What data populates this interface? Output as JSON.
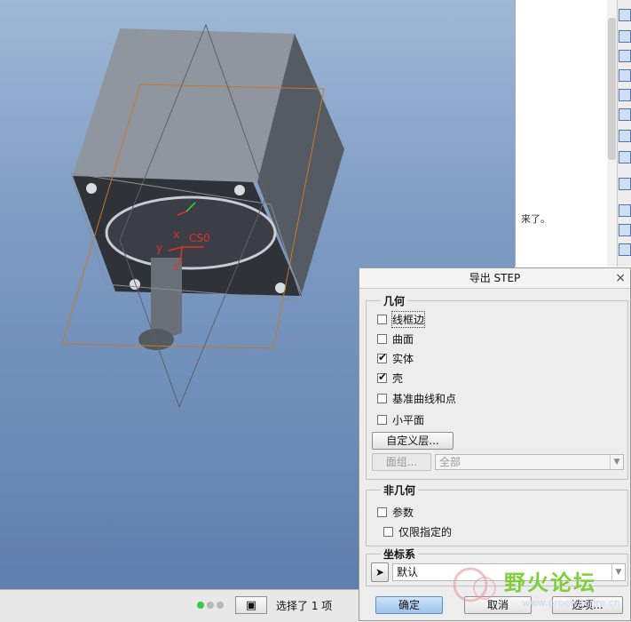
{
  "viewport": {
    "csys_label": "CS0",
    "axis_x": "x",
    "axis_y": "y",
    "axis_z": "z"
  },
  "side_panel": {
    "message": "来了。"
  },
  "dialog": {
    "title": "导出 STEP",
    "close": "×",
    "geometry_group": {
      "label": "几何",
      "items": [
        {
          "label": "线框边",
          "checked": false
        },
        {
          "label": "曲面",
          "checked": false
        },
        {
          "label": "实体",
          "checked": true
        },
        {
          "label": "壳",
          "checked": true
        },
        {
          "label": "基准曲线和点",
          "checked": false
        },
        {
          "label": "小平面",
          "checked": false
        }
      ],
      "custom_layers_button": "自定义层...",
      "quilts_button": "面组...",
      "quilts_select": "全部"
    },
    "nongeometry_group": {
      "label": "非几何",
      "params_label": "参数",
      "params_checked": false,
      "designated_only_label": "仅限指定的",
      "designated_only_checked": false
    },
    "csys_group": {
      "label": "坐标系",
      "select_value": "默认"
    },
    "ok_button": "确定",
    "cancel_button": "取消",
    "options_button": "选项..."
  },
  "status_bar": {
    "selection_text": "选择了 1 项"
  },
  "watermark": {
    "text": "野火论坛",
    "sub": "www.proewildfire.cn"
  },
  "colors": {
    "viewport_top": "#9fb8d6",
    "viewport_bottom": "#5f7fac",
    "motor_body": "#3a3d42",
    "datum_orange": "#c87a2a",
    "csys_red": "#e0302a"
  }
}
